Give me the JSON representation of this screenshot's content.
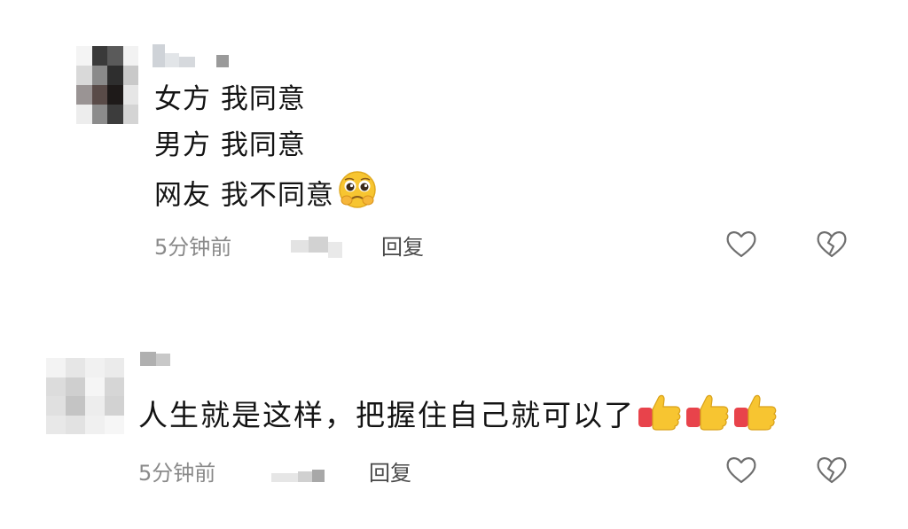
{
  "comments": [
    {
      "lines": [
        "女方 我同意",
        "男方 我同意",
        "网友 我不同意"
      ],
      "emoji": "pleading-face-icon",
      "time": "5分钟前",
      "reply_label": "回复"
    },
    {
      "lines": [
        "人生就是这样，把握住自己就可以了"
      ],
      "emoji": "thumbs-up-icon",
      "emoji_count": 3,
      "time": "5分钟前",
      "reply_label": "回复"
    }
  ],
  "colors": {
    "text": "#141414",
    "meta": "#8a8a8a",
    "reply": "#4a4a4a",
    "icon_stroke": "#6f6f6f",
    "emoji_yellow": "#f7c531",
    "emoji_red": "#e8434b"
  }
}
